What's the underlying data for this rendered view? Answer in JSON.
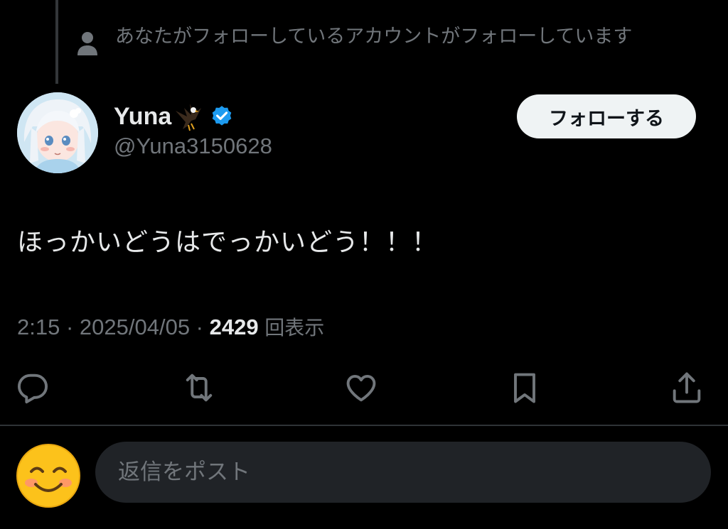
{
  "social_context": {
    "text": "あなたがフォローしているアカウントがフォローしています"
  },
  "author": {
    "display_name": "Yuna",
    "name_emoji": "eagle-emoji",
    "verified": true,
    "handle": "@Yuna3150628"
  },
  "follow_button": {
    "label": "フォローする"
  },
  "post": {
    "text": "ほっかいどうはでっかいどう！！！",
    "time": "2:15",
    "separator": " · ",
    "date": "2025/04/05",
    "views_count": "2429",
    "views_label": "回表示"
  },
  "actions": [
    "reply-icon",
    "repost-icon",
    "like-icon",
    "bookmark-icon",
    "share-icon"
  ],
  "reply": {
    "placeholder": "返信をポスト"
  },
  "colors": {
    "background": "#000000",
    "primary_text": "#e7e9ea",
    "secondary_text": "#71767b",
    "verified_blue": "#1d9bf0",
    "button_bg": "#eff3f4",
    "input_bg": "#202327"
  }
}
